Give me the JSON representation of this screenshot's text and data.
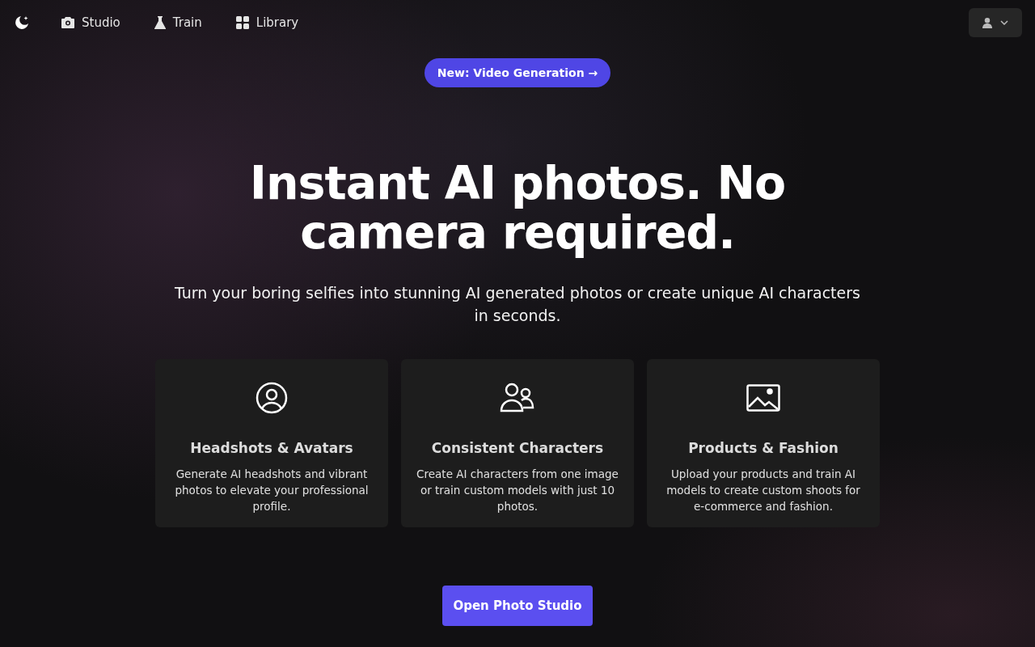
{
  "nav": {
    "items": [
      {
        "label": "Studio"
      },
      {
        "label": "Train"
      },
      {
        "label": "Library"
      }
    ]
  },
  "announcement": "New: Video Generation →",
  "headline": "Instant AI photos. No camera required.",
  "subtitle": "Turn your boring selfies into stunning AI generated photos or create unique AI characters in seconds.",
  "features": [
    {
      "title": "Headshots & Avatars",
      "description": "Generate AI headshots and vibrant photos to elevate your professional profile."
    },
    {
      "title": "Consistent Characters",
      "description": "Create AI characters from one image or train custom models with just 10 photos."
    },
    {
      "title": "Products & Fashion",
      "description": "Upload your products and train AI models to create custom shoots for e-commerce and fashion."
    }
  ],
  "cta": "Open Photo Studio"
}
